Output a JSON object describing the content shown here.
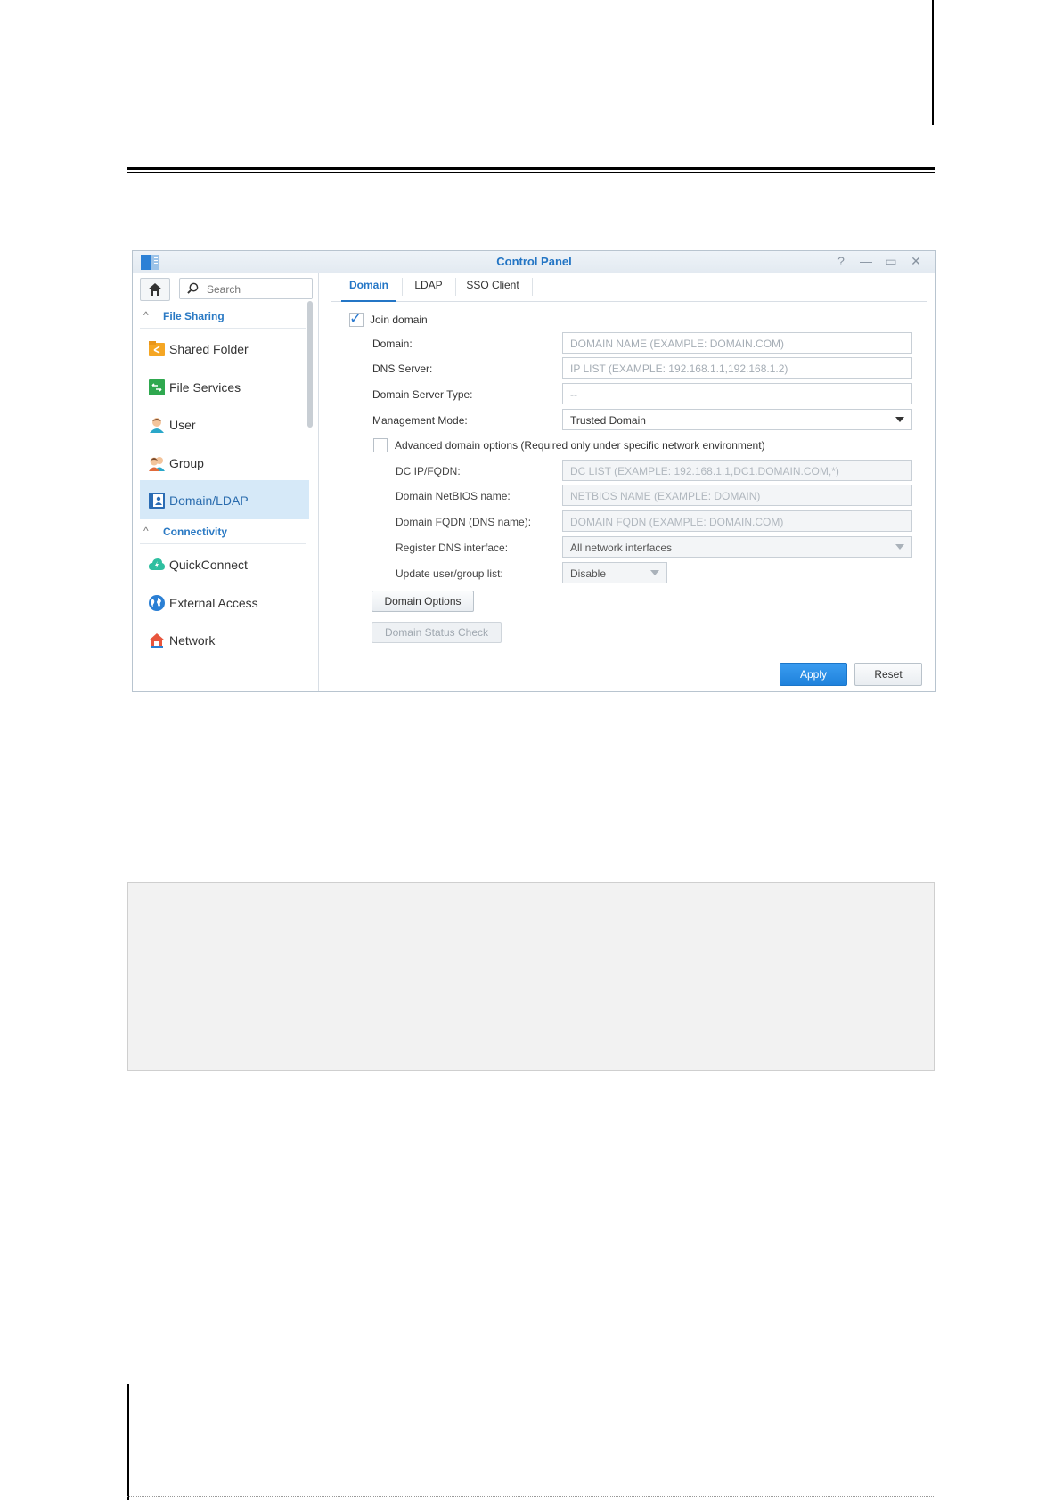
{
  "window": {
    "title": "Control Panel",
    "controls": [
      "?",
      "—",
      "▭",
      "✕"
    ]
  },
  "sidebar": {
    "search_placeholder": "Search",
    "sections": [
      {
        "label": "File Sharing"
      },
      {
        "label": "Connectivity"
      }
    ],
    "items": [
      {
        "label": "Shared Folder",
        "icon": "shared-folder-icon",
        "color": "#f5a623"
      },
      {
        "label": "File Services",
        "icon": "file-services-icon",
        "color": "#2fa84f"
      },
      {
        "label": "User",
        "icon": "user-icon",
        "color": "#2aa7c9"
      },
      {
        "label": "Group",
        "icon": "group-icon",
        "color": "#e06a3b"
      },
      {
        "label": "Domain/LDAP",
        "icon": "domain-ldap-icon",
        "color": "#2b6cb4"
      },
      {
        "label": "QuickConnect",
        "icon": "quickconnect-icon",
        "color": "#2fbfa0"
      },
      {
        "label": "External Access",
        "icon": "globe-icon",
        "color": "#2a7fd4"
      },
      {
        "label": "Network",
        "icon": "network-house-icon",
        "color": "#e8553d"
      }
    ],
    "active_item": "Domain/LDAP"
  },
  "tabs": [
    {
      "label": "Domain",
      "active": true
    },
    {
      "label": "LDAP",
      "active": false
    },
    {
      "label": "SSO Client",
      "active": false
    }
  ],
  "form": {
    "join_domain": {
      "label": "Join domain",
      "checked": true
    },
    "domain": {
      "label": "Domain:",
      "placeholder": "DOMAIN NAME (EXAMPLE: DOMAIN.COM)"
    },
    "dns_server": {
      "label": "DNS Server:",
      "placeholder": "IP LIST (EXAMPLE: 192.168.1.1,192.168.1.2)"
    },
    "server_type": {
      "label": "Domain Server Type:",
      "value": "--"
    },
    "management_mode": {
      "label": "Management Mode:",
      "value": "Trusted Domain"
    },
    "advanced": {
      "label": "Advanced domain options (Required only under specific network environment)",
      "checked": false
    },
    "dc_fqdn": {
      "label": "DC IP/FQDN:",
      "placeholder": "DC LIST (EXAMPLE: 192.168.1.1,DC1.DOMAIN.COM,*)"
    },
    "netbios": {
      "label": "Domain NetBIOS name:",
      "placeholder": "NETBIOS NAME (EXAMPLE: DOMAIN)"
    },
    "fqdn": {
      "label": "Domain FQDN (DNS name):",
      "placeholder": "DOMAIN FQDN (EXAMPLE: DOMAIN.COM)"
    },
    "dns_interface": {
      "label": "Register DNS interface:",
      "value": "All network interfaces"
    },
    "update_list": {
      "label": "Update user/group list:",
      "value": "Disable"
    },
    "domain_options_button": "Domain Options",
    "status_check_button": "Domain Status Check"
  },
  "footer": {
    "apply": "Apply",
    "reset": "Reset"
  },
  "colors": {
    "accent": "#2476c6",
    "apply": "#2387e0",
    "active_bg": "#d6e9f8"
  }
}
